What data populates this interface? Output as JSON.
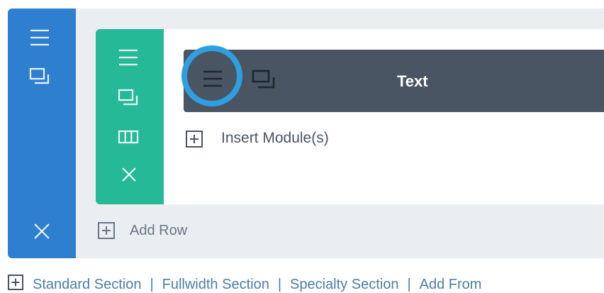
{
  "section": {
    "icons": [
      "hamburger-icon",
      "duplicate-icon",
      "close-icon"
    ],
    "colors": {
      "bar": "#2f7fd0",
      "background": "#ebeef1"
    }
  },
  "row": {
    "icons": [
      "hamburger-icon",
      "duplicate-icon",
      "columns-icon",
      "close-icon"
    ],
    "colors": {
      "bar": "#26b998"
    },
    "insert_module_label": "Insert Module(s)",
    "add_row_label": "Add Row"
  },
  "module": {
    "title": "Text",
    "icons": [
      "hamburger-icon",
      "duplicate-icon"
    ],
    "colors": {
      "background": "#4a5564",
      "highlight_ring": "#2e9fe0"
    }
  },
  "footer": {
    "items": [
      "Standard Section",
      "Fullwidth Section",
      "Specialty Section",
      "Add From"
    ],
    "separator": "|",
    "icon": "plus-box-icon"
  }
}
